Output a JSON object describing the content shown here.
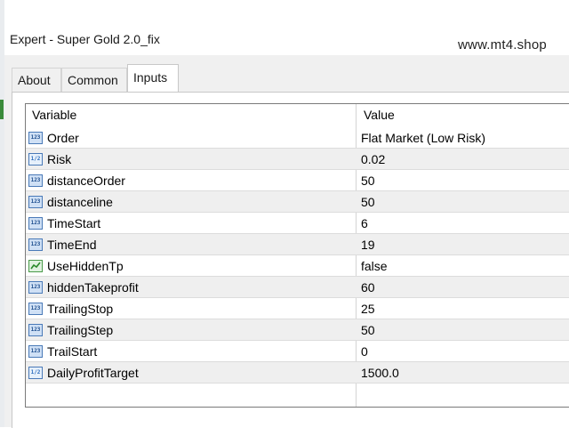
{
  "window": {
    "title": "Expert - Super Gold 2.0_fix",
    "watermark": "www.mt4.shop"
  },
  "tabs": [
    {
      "label": "About",
      "active": false
    },
    {
      "label": "Common",
      "active": false
    },
    {
      "label": "Inputs",
      "active": true
    }
  ],
  "grid": {
    "headers": {
      "variable": "Variable",
      "value": "Value"
    },
    "rows": [
      {
        "name": "Order",
        "value": "Flat Market (Low Risk)",
        "icon": "int-icon",
        "icon_text": "123"
      },
      {
        "name": "Risk",
        "value": "0.02",
        "icon": "double-icon",
        "icon_text": "1/2"
      },
      {
        "name": "distanceOrder",
        "value": "50",
        "icon": "int-icon",
        "icon_text": "123"
      },
      {
        "name": "distanceline",
        "value": "50",
        "icon": "int-icon",
        "icon_text": "123"
      },
      {
        "name": "TimeStart",
        "value": "6",
        "icon": "int-icon",
        "icon_text": "123"
      },
      {
        "name": "TimeEnd",
        "value": "19",
        "icon": "int-icon",
        "icon_text": "123"
      },
      {
        "name": "UseHiddenTp",
        "value": "false",
        "icon": "bool-icon",
        "icon_text": ""
      },
      {
        "name": "hiddenTakeprofit",
        "value": "60",
        "icon": "int-icon",
        "icon_text": "123"
      },
      {
        "name": "TrailingStop",
        "value": "25",
        "icon": "int-icon",
        "icon_text": "123"
      },
      {
        "name": "TrailingStep",
        "value": "50",
        "icon": "int-icon",
        "icon_text": "123"
      },
      {
        "name": "TrailStart",
        "value": "0",
        "icon": "int-icon",
        "icon_text": "123"
      },
      {
        "name": "DailyProfitTarget",
        "value": "1500.0",
        "icon": "double-icon",
        "icon_text": "1/2"
      }
    ]
  },
  "colors": {
    "alt_row": "#efefef",
    "int_icon_border": "#4a7ab8",
    "bool_icon_border": "#4a9a4a"
  }
}
